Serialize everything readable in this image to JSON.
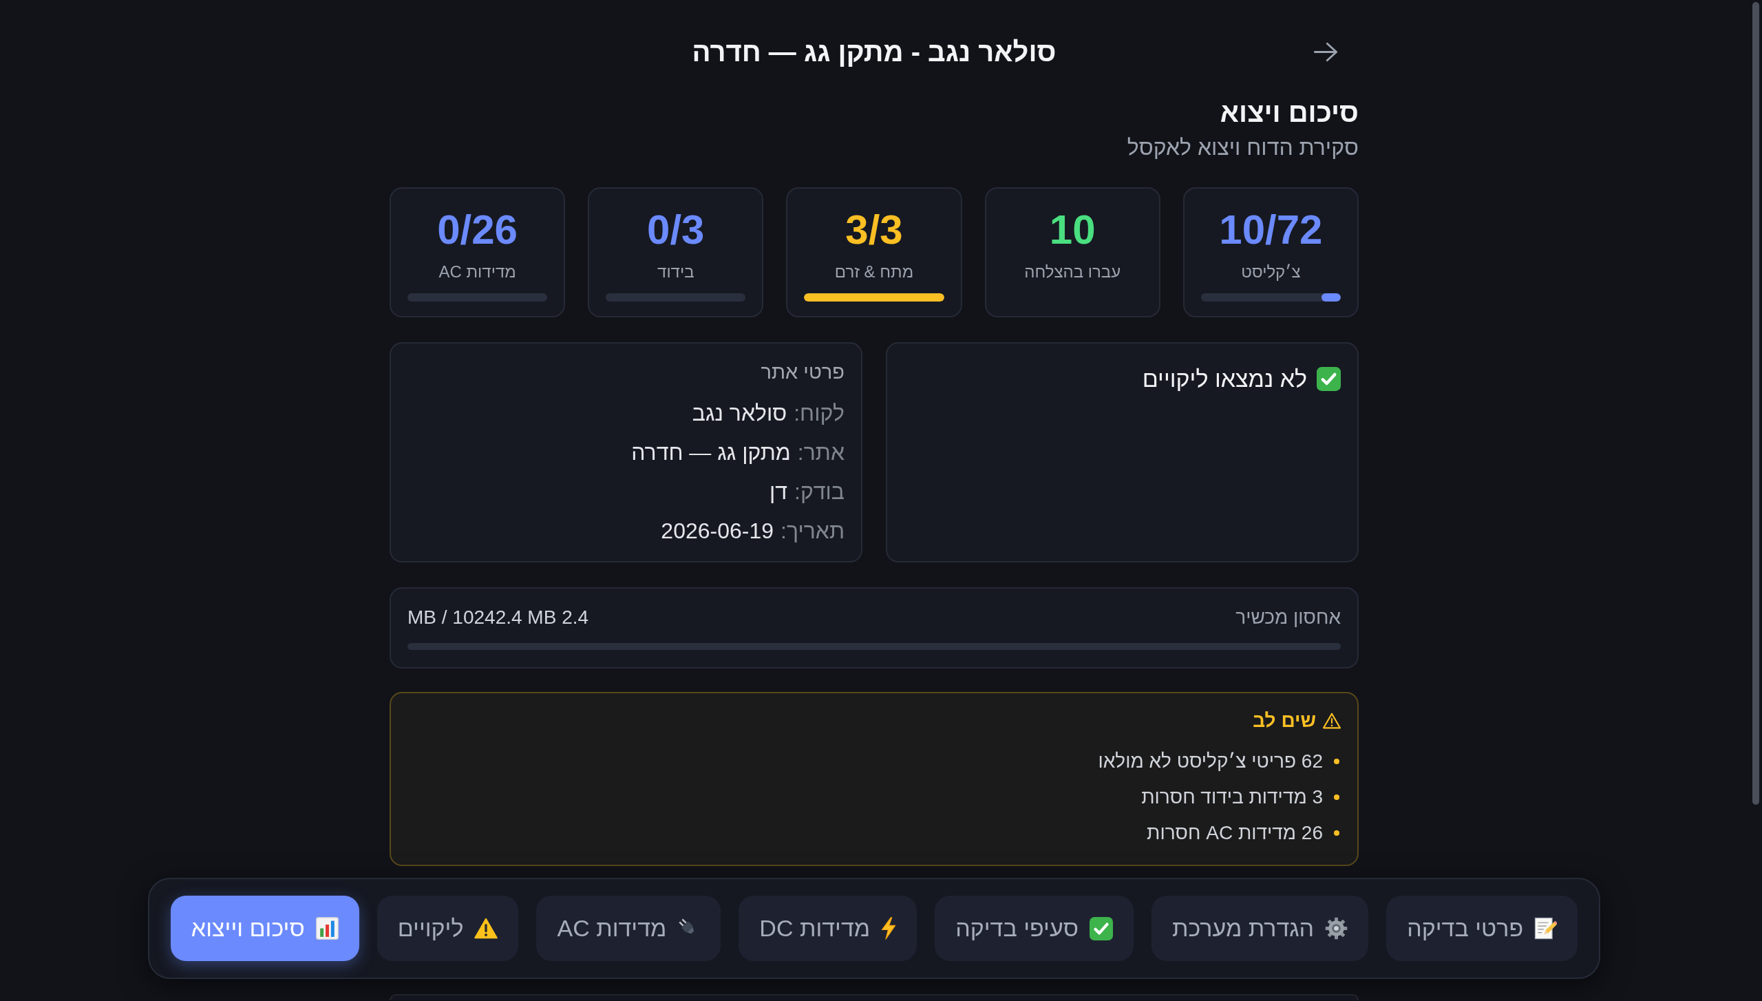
{
  "header": {
    "title": "סולאר נגב - מתקן גג — חדרה"
  },
  "section": {
    "title": "סיכום ויצוא",
    "subtitle": "סקירת הדוח ויצוא לאקסל"
  },
  "stat_cards": [
    {
      "value": "10/72",
      "label": "צ׳קליסט",
      "color": "#6b8afd",
      "level": 0.14
    },
    {
      "value": "10",
      "label": "עברו בהצלחה",
      "color": "#4ade80"
    },
    {
      "value": "3/3",
      "label": "מתח & זרם",
      "color": "#fbbf24",
      "level": 1
    },
    {
      "value": "0/3",
      "label": "בידוד",
      "color": "#6b8afd",
      "level": 0
    },
    {
      "value": "0/26",
      "label": "מדידות AC",
      "color": "#6b8afd",
      "level": 0
    }
  ],
  "defects_card": {
    "title": "לא נמצאו ליקויים"
  },
  "site_details": {
    "title": "פרטי אתר",
    "rows": [
      {
        "label": "לקוח:",
        "value": "סולאר נגב"
      },
      {
        "label": "אתר:",
        "value": "מתקן גג — חדרה"
      },
      {
        "label": "בודק:",
        "value": "דן"
      },
      {
        "label": "תאריך:",
        "value": "2026-06-19"
      }
    ]
  },
  "storage": {
    "label": "אחסון מכשיר",
    "reading": "2.4 MB / 10242.4 MB",
    "level": 0.0002
  },
  "warnings": {
    "title": "שים לב",
    "items": [
      "62 פריטי צ׳קליסט לא מולאו",
      "3 מדידות בידוד חסרות",
      "26 מדידות AC חסרות"
    ]
  },
  "nav_tabs": [
    {
      "label": "פרטי בדיקה",
      "selected": false
    },
    {
      "label": "הגדרת מערכת",
      "selected": false
    },
    {
      "label": "סעיפי בדיקה",
      "selected": false
    },
    {
      "label": "מדידות DC",
      "selected": false
    },
    {
      "label": "מדידות AC",
      "selected": false
    },
    {
      "label": "ליקויים",
      "selected": false
    },
    {
      "label": "סיכום וייצוא",
      "selected": true
    }
  ]
}
